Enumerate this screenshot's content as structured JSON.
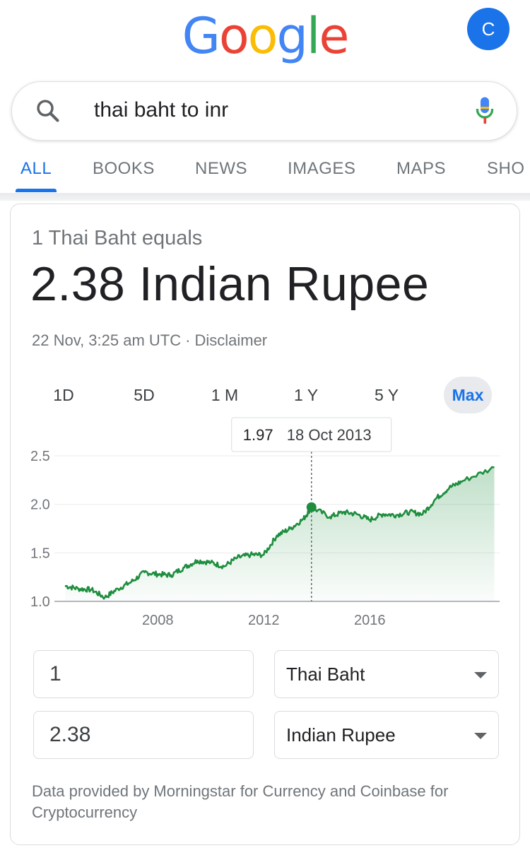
{
  "logo": {
    "letters": [
      "G",
      "o",
      "o",
      "g",
      "l",
      "e"
    ],
    "colors": [
      "#4285F4",
      "#EA4335",
      "#FBBC05",
      "#4285F4",
      "#34A853",
      "#EA4335"
    ]
  },
  "avatar": {
    "initial": "C"
  },
  "search": {
    "query": "thai baht to inr"
  },
  "tabs": [
    {
      "label": "ALL",
      "active": true
    },
    {
      "label": "BOOKS"
    },
    {
      "label": "NEWS"
    },
    {
      "label": "IMAGES"
    },
    {
      "label": "MAPS"
    },
    {
      "label": "SHO"
    }
  ],
  "converter": {
    "equals_label": "1 Thai Baht equals",
    "result": "2.38 Indian Rupee",
    "timestamp": "22 Nov, 3:25 am UTC",
    "separator": "·",
    "disclaimer": "Disclaimer",
    "ranges": [
      {
        "label": "1D"
      },
      {
        "label": "5D"
      },
      {
        "label": "1 M"
      },
      {
        "label": "1 Y"
      },
      {
        "label": "5 Y"
      },
      {
        "label": "Max",
        "active": true
      }
    ],
    "from_amount": "1",
    "from_currency": "Thai Baht",
    "to_amount": "2.38",
    "to_currency": "Indian Rupee",
    "attribution": "Data provided by Morningstar for Currency and Coinbase for Cryptocurrency"
  },
  "chart_data": {
    "type": "area",
    "x": [
      2004.5,
      2005.0,
      2005.5,
      2006.0,
      2006.5,
      2007.0,
      2007.5,
      2008.0,
      2008.5,
      2009.0,
      2009.5,
      2010.0,
      2010.5,
      2011.0,
      2011.5,
      2012.0,
      2012.5,
      2013.0,
      2013.5,
      2013.8,
      2014.5,
      2015.0,
      2015.5,
      2016.0,
      2016.5,
      2017.0,
      2017.5,
      2018.0,
      2018.5,
      2019.0,
      2019.5,
      2020.7
    ],
    "y": [
      1.16,
      1.13,
      1.12,
      1.04,
      1.13,
      1.2,
      1.3,
      1.28,
      1.27,
      1.35,
      1.42,
      1.4,
      1.36,
      1.45,
      1.48,
      1.48,
      1.68,
      1.75,
      1.85,
      1.97,
      1.87,
      1.92,
      1.9,
      1.84,
      1.9,
      1.89,
      1.92,
      1.9,
      2.06,
      2.17,
      2.24,
      2.38
    ],
    "yticks": [
      "1.0",
      "1.5",
      "2.0",
      "2.5"
    ],
    "ytick_values": [
      1.0,
      1.5,
      2.0,
      2.5
    ],
    "xticks": [
      "2008",
      "2012",
      "2016"
    ],
    "xtick_values": [
      2008,
      2012,
      2016
    ],
    "ylim": [
      1.0,
      2.5
    ],
    "xlim": [
      2004.1,
      2020.9
    ],
    "tooltip": {
      "value": "1.97",
      "date": "18 Oct 2013",
      "x": 2013.8,
      "y": 1.97
    },
    "line_color": "#1e8e3e"
  }
}
